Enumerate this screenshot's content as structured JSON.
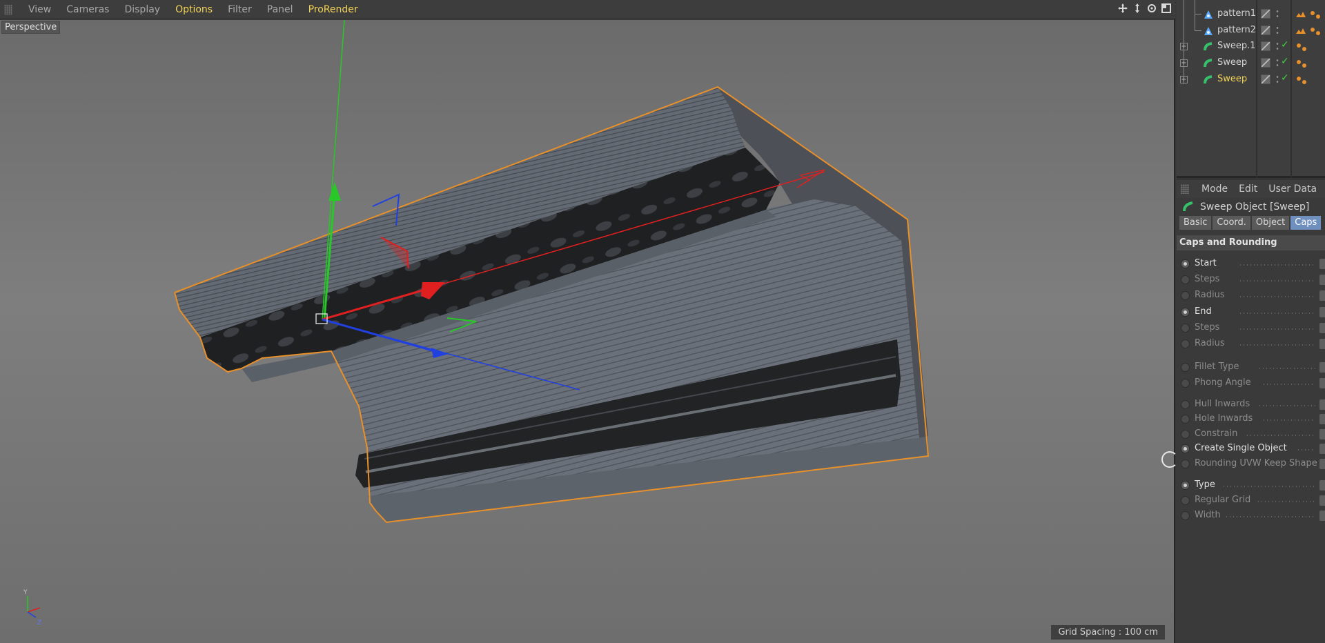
{
  "viewport": {
    "menu": [
      "View",
      "Cameras",
      "Display",
      "Options",
      "Filter",
      "Panel",
      "ProRender"
    ],
    "highlight_menu": [
      "Options",
      "ProRender"
    ],
    "camera_label": "Perspective",
    "grid_spacing": "Grid Spacing : 100 cm",
    "nav_icons": [
      "move-view-icon",
      "zoom-view-icon",
      "rotate-view-icon",
      "toggle-view-icon"
    ],
    "axis_indicator": {
      "y": "Y",
      "z": "Z"
    }
  },
  "object_manager": {
    "objects": [
      {
        "name": "pattern1",
        "type": "spline",
        "tag": "material-tag"
      },
      {
        "name": "pattern2",
        "type": "spline",
        "tag": "material-tag"
      },
      {
        "name": "Sweep.1",
        "type": "sweep",
        "tag": "material-tag",
        "enabled": true
      },
      {
        "name": "Sweep",
        "type": "sweep",
        "tag": "material-tag",
        "enabled": true
      },
      {
        "name": "Sweep",
        "type": "sweep",
        "tag": "material-tag",
        "enabled": true,
        "selected": true
      }
    ]
  },
  "attributes": {
    "menu": [
      "Mode",
      "Edit",
      "User Data"
    ],
    "object_line": "Sweep Object [Sweep]",
    "tabs": [
      "Basic",
      "Coord.",
      "Object",
      "Caps"
    ],
    "active_tab": "Caps",
    "section": "Caps and Rounding",
    "params": [
      {
        "label": "Start",
        "enabled": true
      },
      {
        "label": "Steps",
        "enabled": false
      },
      {
        "label": "Radius",
        "enabled": false
      },
      {
        "label": "End",
        "enabled": true
      },
      {
        "label": "Steps",
        "enabled": false
      },
      {
        "label": "Radius",
        "enabled": false
      },
      {
        "label": "Fillet Type",
        "enabled": false
      },
      {
        "label": "Phong Angle",
        "enabled": false
      },
      {
        "label": "Hull Inwards",
        "enabled": false
      },
      {
        "label": "Hole Inwards",
        "enabled": false
      },
      {
        "label": "Constrain",
        "enabled": false
      },
      {
        "label": "Create Single Object",
        "enabled": true
      },
      {
        "label": "Rounding UVW Keep Shape",
        "enabled": false
      },
      {
        "label": "Type",
        "enabled": true
      },
      {
        "label": "Regular Grid",
        "enabled": false
      },
      {
        "label": "Width",
        "enabled": false
      }
    ]
  },
  "colors": {
    "highlight_menu": "#f2d458",
    "selection_outline": "#e8902a",
    "axis_x": "#e02020",
    "axis_y": "#28c828",
    "axis_z": "#2040e0",
    "active_tab": "#6f8fbf"
  }
}
